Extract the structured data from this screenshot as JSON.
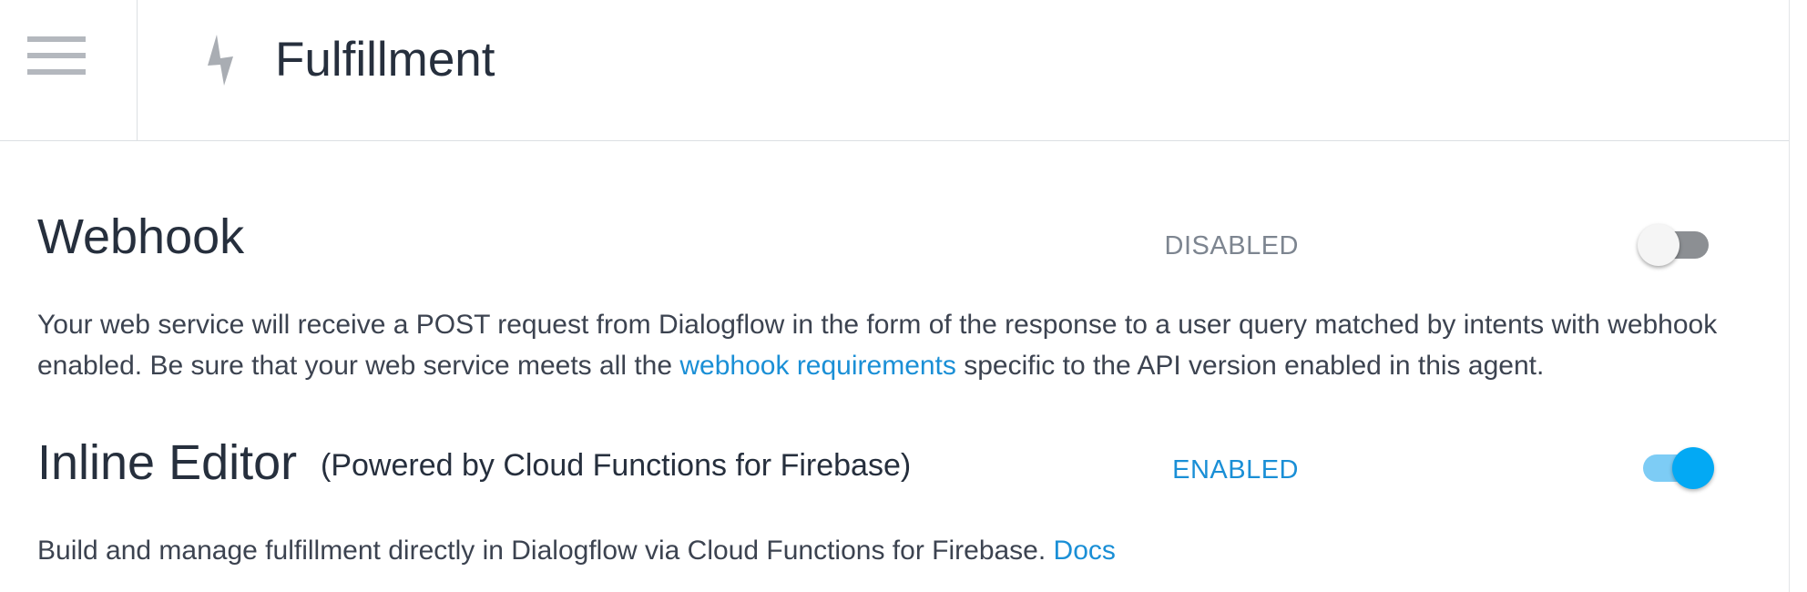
{
  "header": {
    "menu_icon": "hamburger-menu-icon",
    "page_icon": "lightning-bolt-icon",
    "title": "Fulfillment"
  },
  "webhook": {
    "title": "Webhook",
    "status_label": "DISABLED",
    "enabled": false,
    "description_before_link": "Your web service will receive a POST request from Dialogflow in the form of the response to a user query matched by intents with webhook enabled. Be sure that your web service meets all the ",
    "link_text": "webhook requirements",
    "description_after_link": " specific to the API version enabled in this agent."
  },
  "inline_editor": {
    "title": "Inline Editor",
    "subtitle": "(Powered by Cloud Functions for Firebase)",
    "status_label": "ENABLED",
    "enabled": true,
    "description": "Build and manage fulfillment directly in Dialogflow via Cloud Functions for Firebase. ",
    "link_text": "Docs"
  },
  "colors": {
    "accent": "#03a9f4",
    "link": "#1a8fd6",
    "disabled_label": "#7d8590",
    "enabled_label": "#1a8fd6",
    "text": "#262f3d"
  }
}
